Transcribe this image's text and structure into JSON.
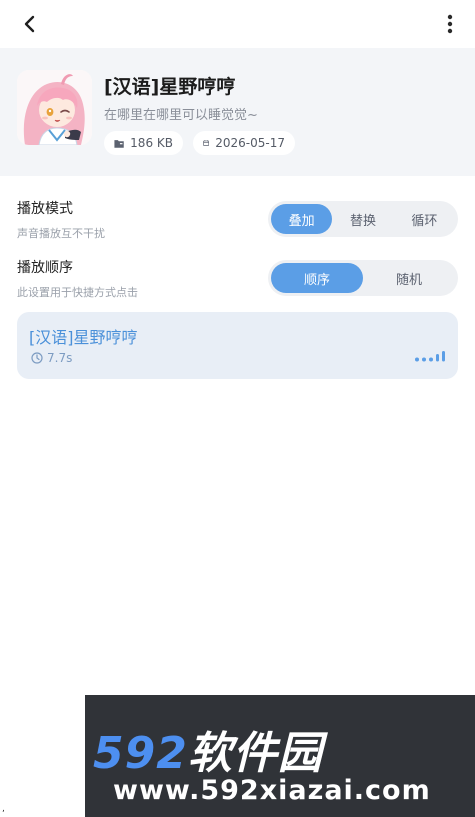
{
  "topbar": {
    "back_icon": "chevron-left-icon",
    "menu_icon": "more-vertical-icon"
  },
  "sound": {
    "title": "[汉语]星野哼哼",
    "subtitle": "在哪里在哪里可以睡觉觉~",
    "size": "186 KB",
    "date": "2026-05-17",
    "size_icon": "folder-icon",
    "date_icon": "calendar-icon"
  },
  "settings": {
    "play_mode": {
      "label": "播放模式",
      "sub": "声音播放互不干扰",
      "options": [
        "叠加",
        "替换",
        "循环"
      ],
      "selected": "叠加"
    },
    "play_order": {
      "label": "播放顺序",
      "sub": "此设置用于快捷方式点击",
      "options": [
        "顺序",
        "随机"
      ],
      "selected": "顺序"
    }
  },
  "list": {
    "items": [
      {
        "title": "[汉语]星野哼哼",
        "duration": "7.7s",
        "duration_icon": "clock-icon",
        "status_icon": "audio-wave-icon"
      }
    ]
  },
  "watermark": {
    "brand_num": "592",
    "brand_text": "软件园",
    "url": "www.592xiazai.com"
  },
  "colors": {
    "accent": "#5b9ee6",
    "header_bg": "#f3f5f8",
    "item_bg": "#e8eef6",
    "item_text": "#4a90d9"
  }
}
